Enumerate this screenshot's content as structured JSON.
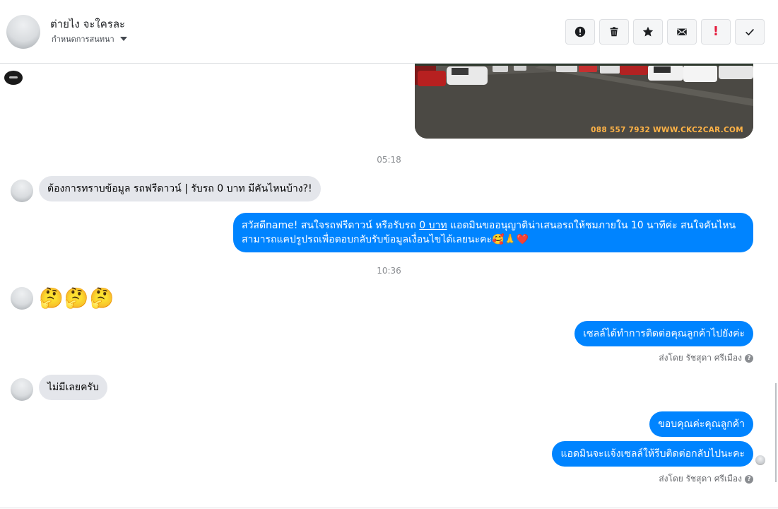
{
  "header": {
    "contact_name": "ต่ายไง จะใครละ",
    "assign_label": "กำหนดการสนทนา",
    "toolbar": [
      {
        "name": "report-button",
        "icon": "exclamation-circle-icon"
      },
      {
        "name": "delete-button",
        "icon": "trash-icon"
      },
      {
        "name": "star-button",
        "icon": "star-icon"
      },
      {
        "name": "mark-unread-button",
        "icon": "envelope-icon"
      },
      {
        "name": "spam-button",
        "icon": "red-exclamation-icon"
      },
      {
        "name": "done-button",
        "icon": "checkmark-icon"
      }
    ]
  },
  "photo": {
    "watermark": "088 557 7932 WWW.CKC2CAR.COM"
  },
  "messages": {
    "ts1": "05:18",
    "in1": "ต้องการทราบข้อมูล รถฟรีดาวน์ | รับรถ 0 บาท มีคันไหนบ้าง?!",
    "out1_a": "สวัสดีname! สนใจรถฟรีดาวน์ หรือรับรถ ",
    "out1_u": "0 บาท",
    "out1_b": " แอดมินขออนุญาติน่าเสนอรถให้ชมภายใน 10 นาทีค่ะ สนใจคันไหนสามารถแคปรูปรถเพื่อตอบกลับรับข้อมูลเงื่อนไขได้เลยนะคะ🥰🙏❤️",
    "ts2": "10:36",
    "in2_emoji": "🤔🤔🤔",
    "out2": "เซลล์ได้ทำการติดต่อคุณลูกค้าไปยังค่ะ",
    "sentby1": "ส่งโดย รัชสุดา ศรีเมือง",
    "in3": "ไม่มีเลยครับ",
    "out3": "ขอบคุณค่ะคุณลูกค้า",
    "out4": "แอดมินจะแจ้งเซลล์ให้รีบติดต่อกลับไปนะคะ",
    "sentby2": "ส่งโดย รัชสุดา ศรีเมือง",
    "help_glyph": "?"
  },
  "colors": {
    "outgoing_bubble": "#0084ff",
    "incoming_bubble": "#e4e6eb",
    "spam_red": "#e41e3f"
  }
}
